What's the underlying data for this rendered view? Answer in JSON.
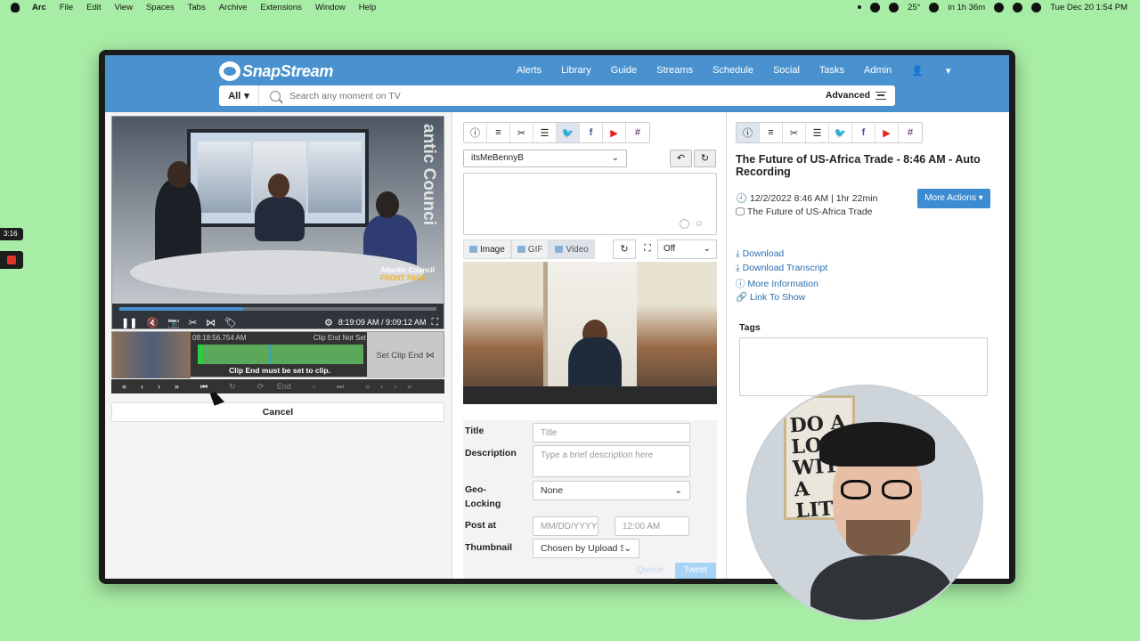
{
  "menubar": {
    "app": "Arc",
    "items": [
      "File",
      "Edit",
      "View",
      "Spaces",
      "Tabs",
      "Archive",
      "Extensions",
      "Window",
      "Help"
    ],
    "weather": "25°",
    "meeting": "in 1h 36m",
    "datetime": "Tue Dec 20  1:54 PM"
  },
  "recorder": {
    "time": "3:16"
  },
  "app": {
    "logo": "SnapStream",
    "nav": [
      "Alerts",
      "Library",
      "Guide",
      "Streams",
      "Schedule",
      "Social",
      "Tasks",
      "Admin"
    ],
    "search": {
      "scope": "All",
      "placeholder": "Search any moment on TV",
      "advanced": "Advanced"
    }
  },
  "player": {
    "watermark": "Atlantic Council",
    "watermark_vertical": "antic Counci",
    "front_page": "FRONT PAGE",
    "progress": 0.39,
    "time": "8:19:09 AM / 9:09:12 AM",
    "clip_start_time": "08:18:56.754 AM",
    "clip_end_status": "Clip End Not Set",
    "clip_message": "Clip End must be set to clip.",
    "set_clip_end": "Set Clip End",
    "end_label": "End",
    "cancel": "Cancel"
  },
  "social": {
    "account": "itsMeBennyB",
    "media_tabs": [
      "Image",
      "GIF",
      "Video"
    ],
    "crop_option": "Off",
    "labels": {
      "title": "Title",
      "description": "Description",
      "geo_line1": "Geo-",
      "geo_line2": "Locking",
      "post_at": "Post at",
      "thumbnail": "Thumbnail"
    },
    "placeholders": {
      "title": "Title",
      "description": "Type a brief description here",
      "date": "MM/DD/YYYY",
      "time": "12:00 AM"
    },
    "geo_value": "None",
    "thumbnail_value": "Chosen by Upload Sit",
    "queue": "Queue",
    "tweet": "Tweet"
  },
  "details": {
    "title": "The Future of US-Africa Trade - 8:46 AM - Auto Recording",
    "datetime": "12/2/2022 8:46 AM | 1hr 22min",
    "show": "The Future of US-Africa Trade",
    "more_actions": "More Actions",
    "links": [
      "Download",
      "Download Transcript",
      "More Information",
      "Link To Show"
    ],
    "tags_label": "Tags"
  },
  "webcam": {
    "art_text": "DO A LOT WITH A LITT"
  },
  "colors": {
    "header": "#4a92cf",
    "accent": "#3d8bd0",
    "desktop": "#a8eda5"
  }
}
